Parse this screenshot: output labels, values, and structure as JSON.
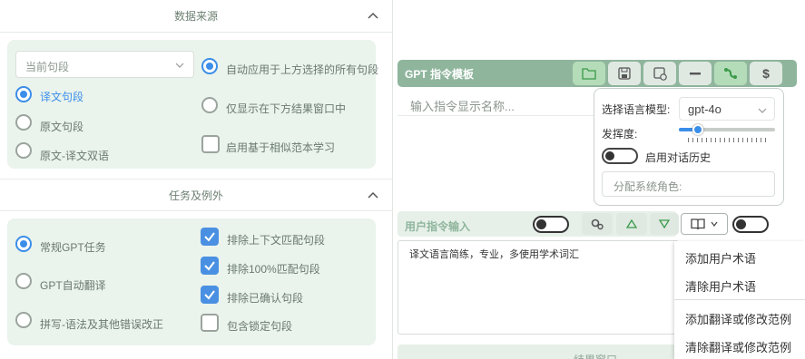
{
  "left": {
    "data_source": {
      "title": "数据来源",
      "dropdown_value": "当前句段",
      "radios": [
        "译文句段",
        "原文句段",
        "原文-译文双语"
      ],
      "options_right": [
        "自动应用于上方选择的所有句段",
        "仅显示在下方结果窗口中",
        "启用基于相似范本学习"
      ]
    },
    "tasks": {
      "title": "任务及例外",
      "radios": [
        "常规GPT任务",
        "GPT自动翻译",
        "拼写-语法及其他错误改正"
      ],
      "checks": [
        "排除上下文匹配句段",
        "排除100%匹配句段",
        "排除已确认句段",
        "包含锁定句段"
      ]
    }
  },
  "right": {
    "template_title": "GPT 指令模板",
    "name_placeholder": "输入指令显示名称...",
    "model_label": "选择语言模型:",
    "model_value": "gpt-4o",
    "temperature_label": "发挥度:",
    "temperature_value": 0.2,
    "history_label": "启用对话历史",
    "role_placeholder": "分配系统角色:",
    "user_input_title": "用户指令输入",
    "instruction_text": "译文语言简练，专业，多使用学术词汇",
    "menu_items": [
      "添加用户术语",
      "清除用户术语",
      "添加翻译或修改范例",
      "清除翻译或修改范例"
    ],
    "bottom_cut_label": "结果窗口"
  },
  "colors": {
    "accent": "#3b8ee8",
    "panel": "#eaf3ec",
    "toolbar": "#8fb59d"
  }
}
